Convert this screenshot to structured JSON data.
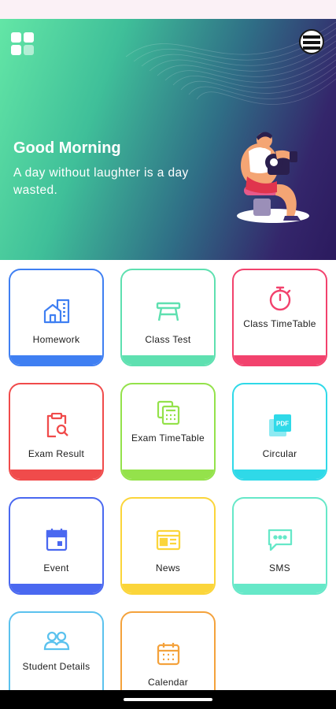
{
  "header": {
    "greeting": "Good Morning",
    "quote": "A day without laughter is a day wasted."
  },
  "icons": {
    "menu": "grid-menu-icon",
    "profile": "profile-avatar-icon"
  },
  "tiles": [
    {
      "label": "Homework",
      "icon": "building-icon",
      "color": "#3f7ff2"
    },
    {
      "label": "Class Test",
      "icon": "desk-icon",
      "color": "#5ee0b0"
    },
    {
      "label": "Class TimeTable",
      "icon": "stopwatch-icon",
      "color": "#f2426d"
    },
    {
      "label": "Exam Result",
      "icon": "clipboard-search-icon",
      "color": "#f04b4b"
    },
    {
      "label": "Exam TimeTable",
      "icon": "calculator-icon",
      "color": "#94e24b"
    },
    {
      "label": "Circular",
      "icon": "pdf-icon",
      "color": "#2fd9e8"
    },
    {
      "label": "Event",
      "icon": "calendar-icon",
      "color": "#4a68f0"
    },
    {
      "label": "News",
      "icon": "newspaper-icon",
      "color": "#fbd53a"
    },
    {
      "label": "SMS",
      "icon": "chat-icon",
      "color": "#66e8c8"
    },
    {
      "label": "Student Details",
      "icon": "users-icon",
      "color": "#5bc2ee"
    },
    {
      "label": "Calendar",
      "icon": "calendar-grid-icon",
      "color": "#f4a23c"
    }
  ]
}
